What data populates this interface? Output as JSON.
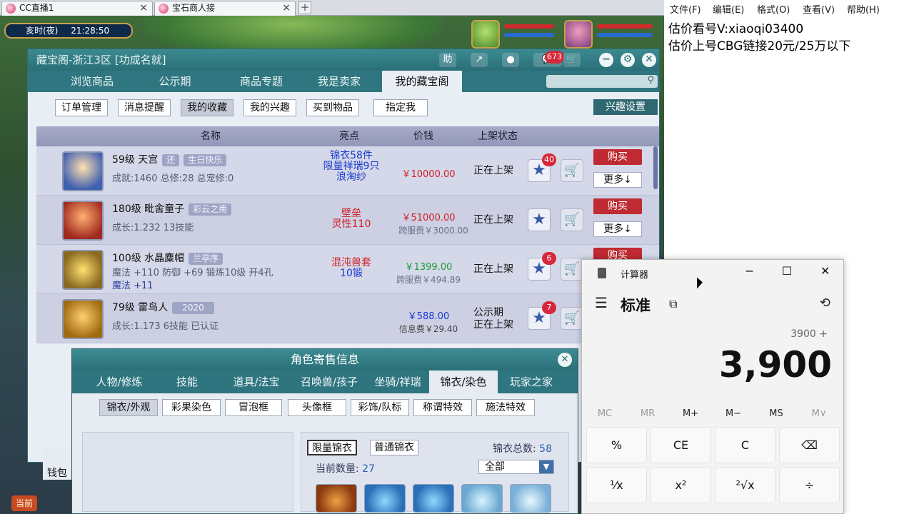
{
  "browser": {
    "tabs": [
      {
        "label": "CC直播1"
      },
      {
        "label": "宝石商人接"
      }
    ],
    "add_tab": "+"
  },
  "game": {
    "time_of_day": "亥时(夜)",
    "clock": "21:28:50",
    "bottom_button": "当前",
    "wallet": "钱包"
  },
  "cbg": {
    "title": "藏宝阁-浙江3区 [功成名就]",
    "title_buttons": {
      "help": "助",
      "share": "↗",
      "record": "●",
      "chat_badge": "673",
      "cart": "🛒",
      "minimize": "−",
      "settings": "⚙",
      "close": "✕"
    },
    "nav_tabs": [
      "浏览商品",
      "公示期",
      "商品专题",
      "我是卖家",
      "我的藏宝阁"
    ],
    "active_nav": "我的藏宝阁",
    "sub_tabs": [
      "订单管理",
      "消息提醒",
      "我的收藏",
      "我的兴趣",
      "买到物品",
      "指定我"
    ],
    "active_sub": "我的收藏",
    "interest_settings": "兴趣设置",
    "table": {
      "headers": {
        "name": "名称",
        "highlight": "亮点",
        "price": "价钱",
        "status": "上架状态"
      },
      "rows": [
        {
          "name": "59级 天宫",
          "tags": [
            "还",
            "生日快乐"
          ],
          "detail": "成就:1460 总修:28 总宠修:0",
          "detail2": "",
          "highlights": [
            "锦衣58件",
            "限量祥瑞9只",
            "浪淘纱"
          ],
          "highlight_color": "#1a3ad0",
          "price": "￥10000.00",
          "price_color": "#d0202a",
          "sub_price": "",
          "status": [
            "正在上架"
          ],
          "star_badge": "40",
          "buy": "购买",
          "more": "更多↓"
        },
        {
          "name": "180级 毗舍童子",
          "tags": [
            "彩云之南"
          ],
          "detail": "成长:1.232 13技能",
          "detail2": "",
          "highlights": [
            "壁垒",
            "灵性110"
          ],
          "highlight_color": "#d0202a",
          "price": "￥51000.00",
          "price_color": "#d0202a",
          "sub_price": "跨服费￥3000.00",
          "status": [
            "正在上架"
          ],
          "star_badge": "",
          "buy": "购买",
          "more": "更多↓"
        },
        {
          "name": "100级 水晶麋帽",
          "tags": [
            "兰亭序"
          ],
          "detail": "魔法 +110 防御 +69 锻炼10级 开4孔",
          "detail2": "魔法 +11",
          "highlights": [
            "混沌兽套",
            "10锻"
          ],
          "highlight_color": "#d0202a",
          "price": "￥1399.00",
          "price_color": "#1a9a3a",
          "sub_price": "跨服费￥494.89",
          "status": [
            "正在上架"
          ],
          "star_badge": "6",
          "buy": "购买",
          "more": ""
        },
        {
          "name": "79级 雷鸟人",
          "tags": [
            "2020"
          ],
          "detail": "成长:1.173 6技能 已认证",
          "detail2": "",
          "highlights": [],
          "highlight_color": "#1a3ad0",
          "price": "￥588.00",
          "price_color": "#1a3ad0",
          "sub_price": "信息费￥29.40",
          "status": [
            "公示期",
            "正在上架"
          ],
          "star_badge": "7",
          "buy": "",
          "more": ""
        }
      ]
    }
  },
  "role_dialog": {
    "title": "角色寄售信息",
    "close": "✕",
    "tabs": [
      "人物/修炼",
      "技能",
      "道具/法宝",
      "召唤兽/孩子",
      "坐骑/祥瑞",
      "锦衣/染色",
      "玩家之家"
    ],
    "active_tab": "锦衣/染色",
    "sub_tabs": [
      "锦衣/外观",
      "彩果染色",
      "冒泡框",
      "头像框",
      "彩饰/队标",
      "称谓特效",
      "施法特效"
    ],
    "active_sub": "锦衣/外观",
    "kinds": [
      "限量锦衣",
      "普通锦衣"
    ],
    "total_label": "锦衣总数:",
    "total_value": "58",
    "count_label": "当前数量:",
    "count_value": "27",
    "filter_value": "全部"
  },
  "notepad": {
    "menus": [
      "文件(F)",
      "编辑(E)",
      "格式(O)",
      "查看(V)",
      "帮助(H)"
    ],
    "lines": [
      "估价看号V:xiaoqi03400",
      "估价上号CBG链接20元/25万以下"
    ]
  },
  "calculator": {
    "title": "计算器",
    "mode": "标准",
    "expression": "3900 +",
    "display": "3,900",
    "memory": [
      "MC",
      "MR",
      "M+",
      "M−",
      "MS",
      "M∨"
    ],
    "keys": [
      "%",
      "CE",
      "C",
      "⌫",
      "¹⁄x",
      "x²",
      "²√x",
      "÷"
    ]
  },
  "colors": {
    "teal": "#2f7680",
    "buy_red": "#c02a32"
  }
}
